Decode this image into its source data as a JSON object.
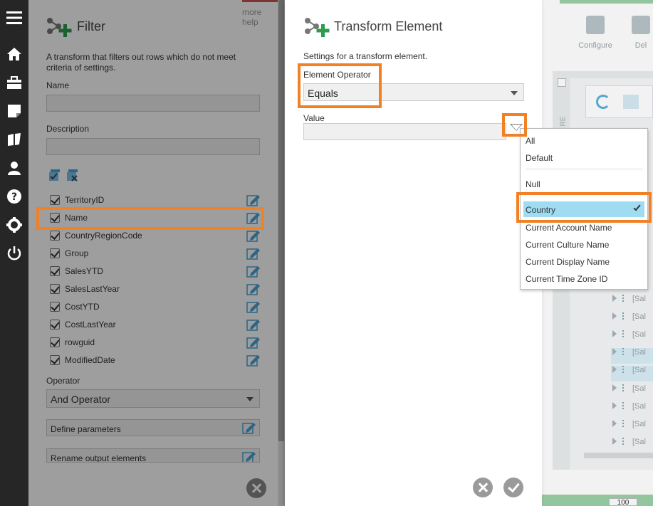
{
  "filter_panel": {
    "more_help": "more help",
    "title": "Filter",
    "description": "A transform that filters out rows which do not meet criteria of settings.",
    "name_label": "Name",
    "description_label": "Description",
    "fields": [
      {
        "label": "TerritoryID"
      },
      {
        "label": "Name"
      },
      {
        "label": "CountryRegionCode"
      },
      {
        "label": "Group"
      },
      {
        "label": "SalesYTD"
      },
      {
        "label": "SalesLastYear"
      },
      {
        "label": "CostYTD"
      },
      {
        "label": "CostLastYear"
      },
      {
        "label": "rowguid"
      },
      {
        "label": "ModifiedDate"
      }
    ],
    "operator_label": "Operator",
    "operator_value": "And Operator",
    "define_parameters": "Define parameters",
    "rename_output": "Rename output elements"
  },
  "dialog": {
    "title": "Transform Element",
    "description": "Settings for a transform element.",
    "element_operator_label": "Element Operator",
    "element_operator_value": "Equals",
    "value_label": "Value"
  },
  "dropdown": {
    "items_top": [
      "All",
      "Default"
    ],
    "null_item": "Null",
    "selected": "Country",
    "items_rest": [
      "Current Account Name",
      "Current Culture Name",
      "Current Display Name",
      "Current Time Zone ID"
    ]
  },
  "background": {
    "toolbar": [
      "Configure",
      "Del"
    ],
    "tree_label": "[Sal",
    "side_label": "RE",
    "pager": "100"
  },
  "colors": {
    "highlight": "#f28024",
    "selected_row": "#9fdcf2",
    "nav_bg": "#262626",
    "accent_green": "#2e9b4f"
  }
}
